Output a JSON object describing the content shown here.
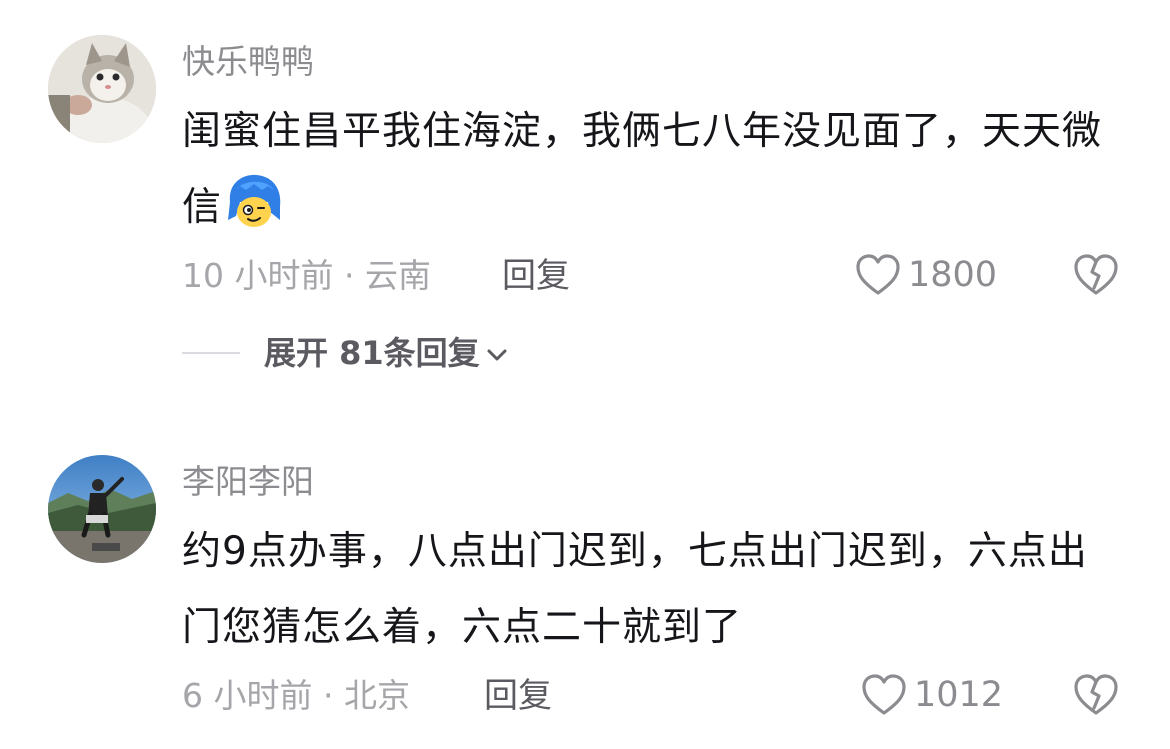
{
  "comments": [
    {
      "username": "快乐鸭鸭",
      "avatar_icon": "cat-avatar",
      "text": "闺蜜住昌平我住海淀，我俩七八年没见面了，天天微信",
      "emoji_icon": "blue-hair-face-emoji",
      "time": "10 小时前",
      "location": "云南",
      "meta": "10 小时前 · 云南",
      "reply_label": "回复",
      "like_count": "1800",
      "like_icon": "heart-outline-icon",
      "dislike_icon": "broken-heart-icon"
    },
    {
      "username": "李阳李阳",
      "avatar_icon": "person-mountain-avatar",
      "text": "约9点办事，八点出门迟到，七点出门迟到，六点出门您猜怎么着，六点二十就到了",
      "time": "6 小时前",
      "location": "北京",
      "meta": "6 小时前 · 北京",
      "reply_label": "回复",
      "like_count": "1012",
      "like_icon": "heart-outline-icon",
      "dislike_icon": "broken-heart-icon"
    }
  ],
  "expand_replies": {
    "label": "展开 81条回复",
    "icon": "chevron-down-icon"
  },
  "colors": {
    "username": "#8c8c90",
    "text": "#16161a",
    "meta": "#a6a6aa",
    "action": "#5a5a60"
  }
}
